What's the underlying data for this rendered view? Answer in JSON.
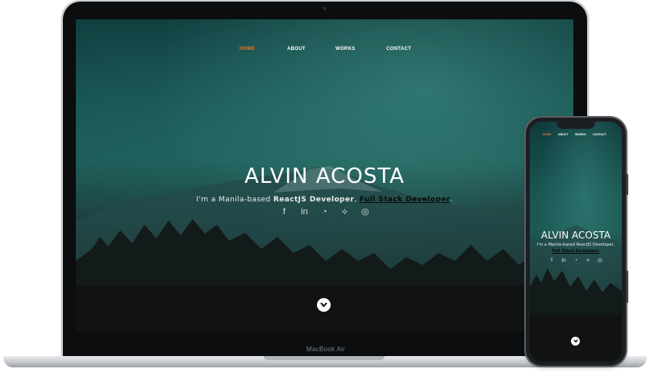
{
  "laptop": {
    "model_label": "MacBook Air"
  },
  "site": {
    "nav": [
      {
        "label": "HOME",
        "active": true
      },
      {
        "label": "ABOUT",
        "active": false
      },
      {
        "label": "WORKS",
        "active": false
      },
      {
        "label": "CONTACT",
        "active": false
      }
    ],
    "name": "ALVIN ACOSTA",
    "tagline_prefix": "I'm a Manila-based ",
    "tagline_role": "ReactJS Developer",
    "tagline_sep": ", ",
    "tagline_link": "Full Stack Developer",
    "tagline_end": ".",
    "phone_tagline_line1": "I'm a Manila-based ReactJS Developer,",
    "phone_tagline_link": "Full Stack Developer.",
    "socials": [
      {
        "icon": "facebook-icon",
        "glyph": "f"
      },
      {
        "icon": "linkedin-icon",
        "glyph": "in"
      },
      {
        "icon": "github-icon",
        "glyph": "◔"
      },
      {
        "icon": "codepen-icon",
        "glyph": "⟡"
      },
      {
        "icon": "instagram-icon",
        "glyph": "◎"
      }
    ]
  },
  "colors": {
    "accent": "#e07a35",
    "hero_top": "#0e3b3c",
    "hero_bottom": "#101212"
  }
}
